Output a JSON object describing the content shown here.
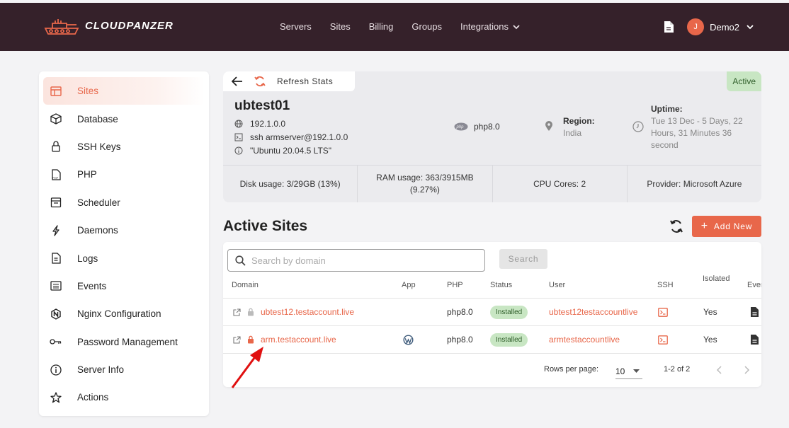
{
  "brand": {
    "name": "CLOUDPANZER"
  },
  "nav": {
    "servers": "Servers",
    "sites": "Sites",
    "billing": "Billing",
    "groups": "Groups",
    "integrations": "Integrations"
  },
  "user": {
    "initial": "J",
    "name": "Demo2"
  },
  "sidebar": {
    "items": [
      {
        "label": "Sites"
      },
      {
        "label": "Database"
      },
      {
        "label": "SSH Keys"
      },
      {
        "label": "PHP"
      },
      {
        "label": "Scheduler"
      },
      {
        "label": "Daemons"
      },
      {
        "label": "Logs"
      },
      {
        "label": "Events"
      },
      {
        "label": "Nginx Configuration"
      },
      {
        "label": "Password Management"
      },
      {
        "label": "Server Info"
      },
      {
        "label": "Actions"
      }
    ]
  },
  "server": {
    "refresh_label": "Refresh Stats",
    "status": "Active",
    "name": "ubtest01",
    "ip": "192.1.0.0",
    "ssh": "ssh armserver@192.1.0.0",
    "os": "\"Ubuntu 20.04.5 LTS\"",
    "php": "php8.0",
    "region_label": "Region:",
    "region": "India",
    "uptime_label": "Uptime:",
    "uptime": "Tue 13 Dec - 5 Days, 22 Hours, 31 Minutes 36 second",
    "disk_label": "Disk usage:",
    "disk": "3/29GB (13%)",
    "ram_label": "RAM usage:",
    "ram": "363/3915MB (9.27%)",
    "cpu_label": "CPU Cores:",
    "cpu": "2",
    "provider_label": "Provider:",
    "provider": "Microsoft Azure"
  },
  "sites": {
    "title": "Active Sites",
    "add_label": "Add New",
    "search_placeholder": "Search by domain",
    "search_button": "Search",
    "columns": {
      "domain": "Domain",
      "app": "App",
      "php": "PHP",
      "status": "Status",
      "user": "User",
      "ssh": "SSH",
      "isolated": "Isolated",
      "events": "Even"
    },
    "rows": [
      {
        "domain": "ubtest12.testaccount.live",
        "app": "",
        "php": "php8.0",
        "status": "Installed",
        "user": "ubtest12testaccountlive",
        "isolated": "Yes",
        "ssl_locked": false
      },
      {
        "domain": "arm.testaccount.live",
        "app": "wordpress",
        "php": "php8.0",
        "status": "Installed",
        "user": "armtestaccountlive",
        "isolated": "Yes",
        "ssl_locked": true
      }
    ],
    "rows_per_page_label": "Rows per page:",
    "rows_per_page": "10",
    "range": "1-2 of 2"
  },
  "colors": {
    "accent": "#e8674a",
    "topbar": "#35212a",
    "success_bg": "#c8e6c3",
    "annotation": "#e01010"
  }
}
